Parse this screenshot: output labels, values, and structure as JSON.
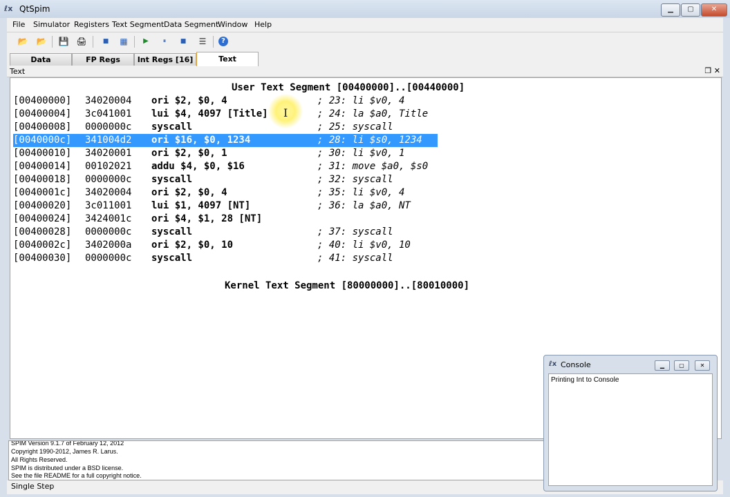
{
  "window": {
    "title": "QtSpim",
    "app_icon": "QtSpim-icon",
    "minimize_glyph": "▁",
    "maximize_glyph": "▢",
    "close_glyph": "✕"
  },
  "menu": [
    "File",
    "Simulator",
    "Registers",
    "Text Segment",
    "Data Segment",
    "Window",
    "Help"
  ],
  "toolbar": {
    "icons": [
      "open-icon",
      "reload-icon",
      "save-icon",
      "print-icon",
      "clear-registers-icon",
      "reinitialize-icon",
      "run-icon",
      "pause-icon",
      "stop-icon",
      "single-step-icon",
      "help-icon"
    ],
    "glyphs": [
      "📂",
      "📂",
      "💾",
      "🖨",
      "■",
      "▦",
      "▶",
      "⏸",
      "■",
      "☰",
      "?"
    ]
  },
  "tabs": [
    {
      "label": "Data",
      "active": false
    },
    {
      "label": "FP Regs",
      "active": false
    },
    {
      "label": "Int Regs [16]",
      "active": false
    },
    {
      "label": "Text",
      "active": true
    }
  ],
  "dock": {
    "title": "Text",
    "float_glyph": "❐",
    "close_glyph": "✕"
  },
  "text_segment": {
    "user_header": "User Text Segment [00400000]..[00440000]",
    "kernel_header": "Kernel Text Segment [80000000]..[80010000]",
    "lines": [
      {
        "addr": "[00400000]",
        "hex": "34020004",
        "instr": "ori $2, $0, 4",
        "comment": "; 23: li $v0, 4"
      },
      {
        "addr": "[00400004]",
        "hex": "3c041001",
        "instr": "lui $4, 4097 [Title]",
        "comment": "; 24: la $a0, Title"
      },
      {
        "addr": "[00400008]",
        "hex": "0000000c",
        "instr": "syscall",
        "comment": "; 25: syscall"
      },
      {
        "addr": "[0040000c]",
        "hex": "341004d2",
        "instr": "ori $16, $0, 1234",
        "comment": "; 28: li $s0, 1234",
        "selected": true
      },
      {
        "addr": "[00400010]",
        "hex": "34020001",
        "instr": "ori $2, $0, 1",
        "comment": "; 30: li $v0, 1"
      },
      {
        "addr": "[00400014]",
        "hex": "00102021",
        "instr": "addu $4, $0, $16",
        "comment": "; 31: move $a0, $s0"
      },
      {
        "addr": "[00400018]",
        "hex": "0000000c",
        "instr": "syscall",
        "comment": "; 32: syscall"
      },
      {
        "addr": "[0040001c]",
        "hex": "34020004",
        "instr": "ori $2, $0, 4",
        "comment": "; 35: li $v0, 4"
      },
      {
        "addr": "[00400020]",
        "hex": "3c011001",
        "instr": "lui $1, 4097 [NT]",
        "comment": "; 36: la $a0, NT"
      },
      {
        "addr": "[00400024]",
        "hex": "3424001c",
        "instr": "ori $4, $1, 28 [NT]",
        "comment": ""
      },
      {
        "addr": "[00400028]",
        "hex": "0000000c",
        "instr": "syscall",
        "comment": "; 37: syscall"
      },
      {
        "addr": "[0040002c]",
        "hex": "3402000a",
        "instr": "ori $2, $0, 10",
        "comment": "; 40: li $v0, 10"
      },
      {
        "addr": "[00400030]",
        "hex": "0000000c",
        "instr": "syscall",
        "comment": "; 41: syscall"
      }
    ]
  },
  "messages": [
    "SPIM Version 9.1.7 of February 12, 2012",
    "Copyright 1990-2012, James R. Larus.",
    "All Rights Reserved.",
    "SPIM is distributed under a BSD license.",
    "See the file README for a full copyright notice."
  ],
  "status": {
    "text": "Single Step"
  },
  "console": {
    "title": "Console",
    "output": "Printing Int to Console",
    "minimize_glyph": "▁",
    "maximize_glyph": "▢",
    "close_glyph": "✕"
  },
  "colors": {
    "selection": "#3399ff",
    "active_tab_border": "#e8a33c"
  }
}
